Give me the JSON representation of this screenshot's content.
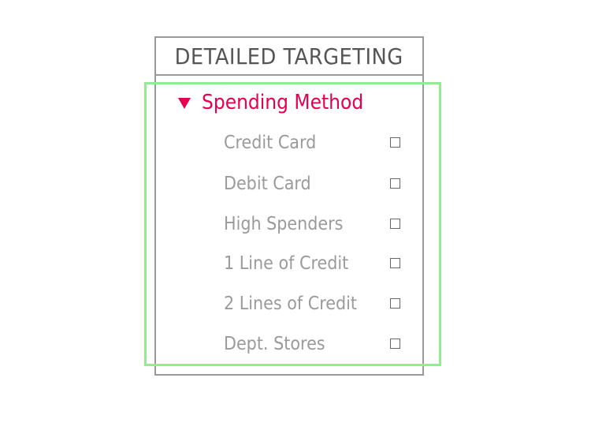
{
  "panel": {
    "title": "DETAILED TARGETING"
  },
  "section": {
    "label": "Spending Method",
    "expanded": true,
    "accent_color": "#e8004f",
    "expand_icon": "triangle-down-icon"
  },
  "options": [
    {
      "label": "Credit Card",
      "checked": false
    },
    {
      "label": "Debit Card",
      "checked": false
    },
    {
      "label": "High Spenders",
      "checked": false
    },
    {
      "label": "1 Line of Credit",
      "checked": false
    },
    {
      "label": "2 Lines of Credit",
      "checked": false
    },
    {
      "label": "Dept. Stores",
      "checked": false
    }
  ],
  "colors": {
    "highlight_border": "#90ee90",
    "panel_border": "#999999",
    "option_text": "#9a9a9a"
  }
}
